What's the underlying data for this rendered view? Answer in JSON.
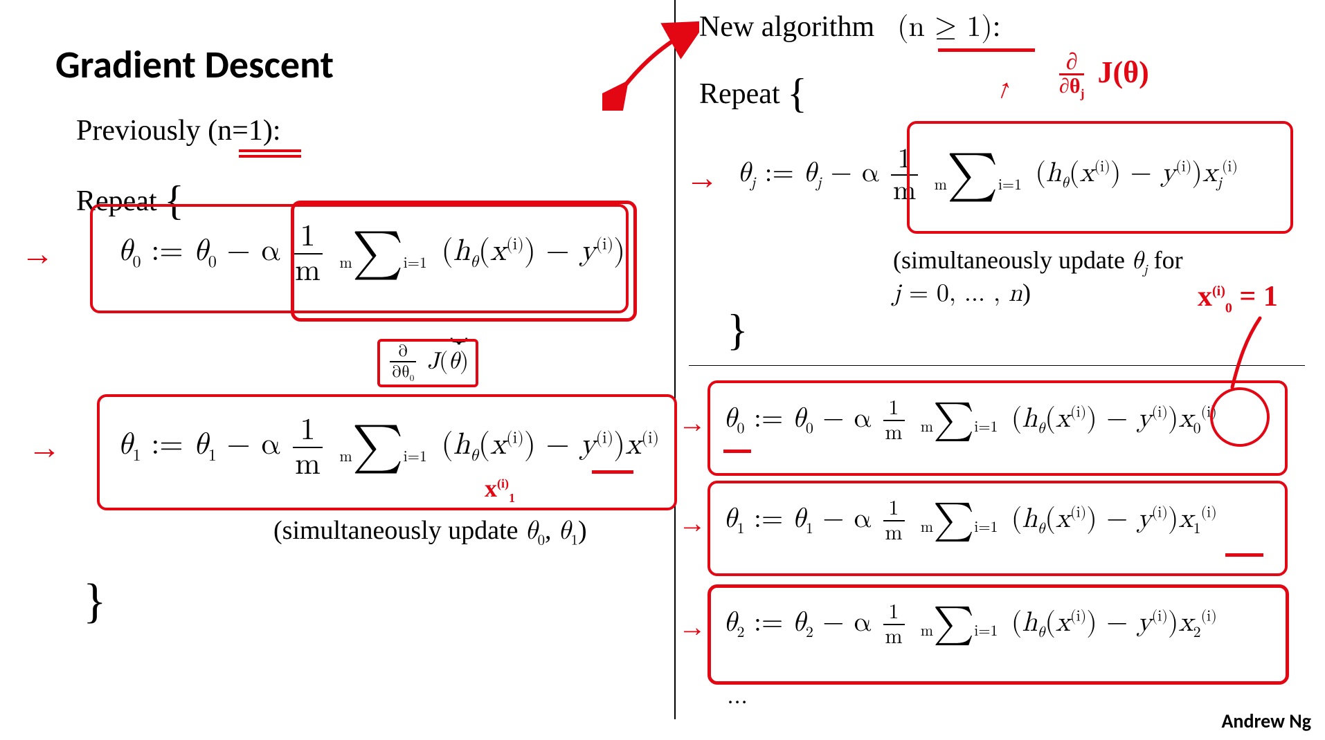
{
  "title": "Gradient Descent",
  "credit": "Andrew Ng",
  "left": {
    "previously_label": "Previously (n=1):",
    "repeat_label": "Repeat",
    "eq_theta0": "θ₀ := θ₀ − α (1/m) Σ_{i=1}^{m} (h_θ(x^{(i)}) − y^{(i)})",
    "eq_theta1": "θ₁ := θ₁ − α (1/m) Σ_{i=1}^{m} (h_θ(x^{(i)}) − y^{(i)}) x^{(i)}",
    "partial_label": "∂/∂θ₀ J(θ)",
    "simultaneous_label": "(simultaneously update θ₀, θ₁)",
    "close_brace": "}"
  },
  "right": {
    "new_label": "New algorithm",
    "n_condition": "(n ≥ 1):",
    "repeat_label": "Repeat",
    "eq_general": "θⱼ := θⱼ − α (1/m) Σ_{i=1}^{m} (h_θ(x^{(i)}) − y^{(i)}) xⱼ^{(i)}",
    "simultaneous_label_line1": "(simultaneously update θⱼ for",
    "simultaneous_label_line2": "j = 0, …, n)",
    "eq_theta0": "θ₀ := θ₀ − α (1/m) Σ_{i=1}^{m} (h_θ(x^{(i)}) − y^{(i)}) x₀^{(i)}",
    "eq_theta1": "θ₁ := θ₁ − α (1/m) Σ_{i=1}^{m} (h_θ(x^{(i)}) − y^{(i)}) x₁^{(i)}",
    "eq_theta2": "θ₂ := θ₂ − α (1/m) Σ_{i=1}^{m} (h_θ(x^{(i)}) − y^{(i)}) x₂^{(i)}",
    "dots": "…"
  },
  "annotations": {
    "partial_deriv_note": "∂/∂θⱼ J(θ)",
    "x0_equals_one": "x₀^{(i)} = 1",
    "x1_note": "x₁^{(i)}"
  }
}
